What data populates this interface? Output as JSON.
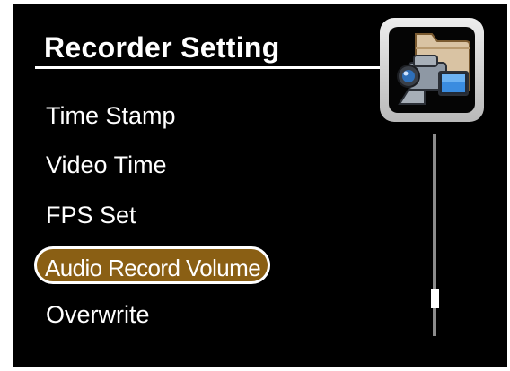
{
  "screen": {
    "title": "Recorder Setting",
    "icon": "camcorder-folder-icon"
  },
  "menu": {
    "items": [
      {
        "label": "Time Stamp",
        "selected": false
      },
      {
        "label": "Video Time",
        "selected": false
      },
      {
        "label": "FPS Set",
        "selected": false
      },
      {
        "label": "Audio Record Volume",
        "selected": true
      },
      {
        "label": "Overwrite",
        "selected": false
      }
    ],
    "selected_index": 3
  },
  "scrollbar": {
    "position_fraction": 0.85
  },
  "colors": {
    "background": "#000000",
    "text": "#ffffff",
    "highlight": "#8a5f14",
    "scroll_track": "#8c8c8c"
  }
}
